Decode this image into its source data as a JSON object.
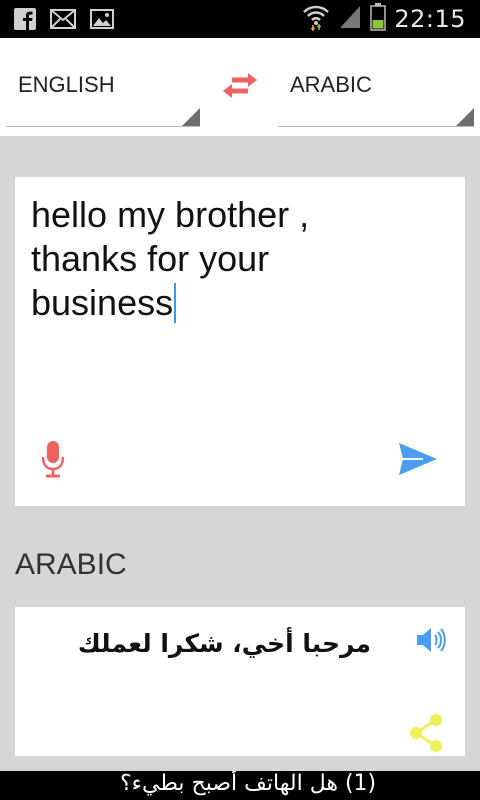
{
  "status_bar": {
    "time": "22:15",
    "left_icons": [
      "facebook-icon",
      "mail-icon",
      "image-icon"
    ],
    "right_icons": [
      "wifi-icon",
      "signal-icon",
      "battery-icon"
    ]
  },
  "languages": {
    "source": "ENGLISH",
    "target": "ARABIC",
    "swap_icon": "swap-arrows-icon"
  },
  "input": {
    "text": "hello my brother ,\nthanks for your\nbusiness",
    "mic_icon": "microphone-icon",
    "send_icon": "send-icon"
  },
  "output": {
    "label": "ARABIC",
    "text": "مرحبا أخي، شكرا لعملك",
    "speaker_icon": "speaker-icon",
    "share_icon": "share-icon"
  },
  "bottom_bar": {
    "text": "(1) هل الهاتف أصبح بطيء؟"
  },
  "colors": {
    "accent_red": "#f06262",
    "accent_blue": "#4a9df0",
    "share_yellow": "#eef05a",
    "background_gray": "#d6d6d6"
  }
}
